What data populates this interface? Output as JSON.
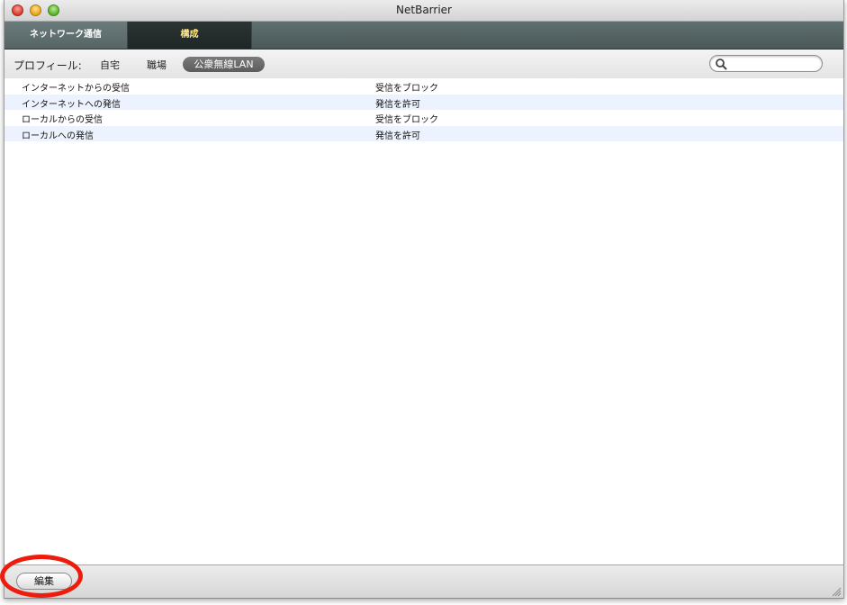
{
  "window": {
    "title": "NetBarrier"
  },
  "tabs": [
    {
      "label": "ネットワーク通信",
      "active": false
    },
    {
      "label": "構成",
      "active": true
    }
  ],
  "profile": {
    "label": "プロフィール:",
    "options": [
      "自宅",
      "職場",
      "公衆無線LAN"
    ],
    "selected": "公衆無線LAN"
  },
  "search": {
    "value": "",
    "placeholder": ""
  },
  "rules": [
    {
      "name": "インターネットからの受信",
      "action": "受信をブロック"
    },
    {
      "name": "インターネットへの発信",
      "action": "発信を許可"
    },
    {
      "name": "ローカルからの受信",
      "action": "受信をブロック"
    },
    {
      "name": "ローカルへの発信",
      "action": "発信を許可"
    }
  ],
  "footer": {
    "edit_label": "編集"
  },
  "colors": {
    "active_tab_text": "#ffe98c",
    "highlight_ring": "#ee1c0c",
    "row_alt": "#edf3fe"
  }
}
